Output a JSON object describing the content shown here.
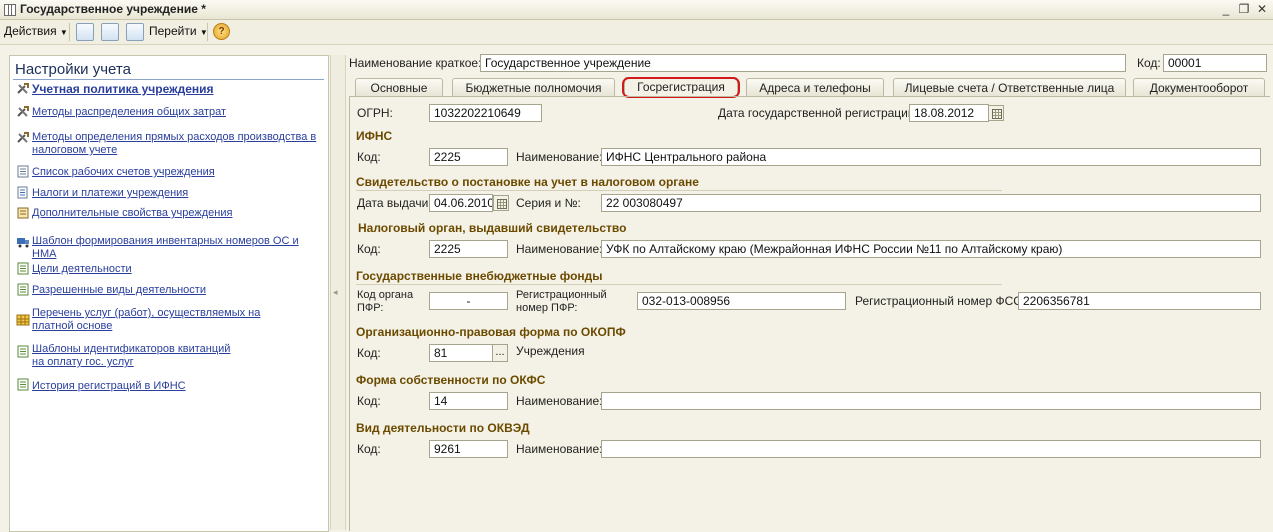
{
  "window": {
    "title": "Государственное учреждение *",
    "minimize": "_",
    "restore": "❐",
    "close": "✕"
  },
  "toolbar": {
    "actions_label": "Действия",
    "goto_label": "Перейти",
    "help_label": "?"
  },
  "left_panel": {
    "heading": "Настройки учета",
    "items": [
      {
        "label": "Учетная политика учреждения",
        "icon": "tools-icon"
      },
      {
        "label": "Методы распределения общих затрат",
        "icon": "tools-icon"
      },
      {
        "label": "Методы определения прямых расходов производства в налоговом учете",
        "icon": "tools-icon"
      },
      {
        "label": "Список рабочих счетов учреждения",
        "icon": "list-icon"
      },
      {
        "label": "Налоги и платежи учреждения",
        "icon": "document-icon"
      },
      {
        "label": "Дополнительные свойства учреждения",
        "icon": "properties-icon"
      },
      {
        "label": "Шаблон формирования инвентарных номеров ОС и НМА",
        "icon": "truck-icon"
      },
      {
        "label": "Цели деятельности",
        "icon": "list-icon"
      },
      {
        "label": "Разрешенные виды деятельности",
        "icon": "list-icon"
      },
      {
        "label": "Перечень услуг (работ), осуществляемых на платной основе",
        "icon": "table-icon"
      },
      {
        "label": "Шаблоны идентификаторов квитанций на оплату гос. услуг",
        "icon": "list-icon"
      },
      {
        "label": "История регистраций в ИФНС",
        "icon": "list-icon"
      }
    ]
  },
  "header": {
    "short_name_label": "Наименование краткое:",
    "short_name_value": "Государственное учреждение",
    "code_label": "Код:",
    "code_value": "00001"
  },
  "tabs": [
    {
      "label": "Основные"
    },
    {
      "label": "Бюджетные полномочия"
    },
    {
      "label": "Госрегистрация"
    },
    {
      "label": "Адреса и телефоны"
    },
    {
      "label": "Лицевые счета / Ответственные лица"
    },
    {
      "label": "Документооборот"
    }
  ],
  "form": {
    "ogrn_label": "ОГРН:",
    "ogrn_value": "1032202210649",
    "reg_date_label": "Дата государственной регистрации:",
    "reg_date_value": "18.08.2012",
    "ifns": {
      "title": "ИФНС",
      "code_label": "Код:",
      "code_value": "2225",
      "name_label": "Наименование:",
      "name_value": "ИФНС Центрального района"
    },
    "certificate": {
      "title": "Свидетельство о постановке на учет в налоговом органе",
      "issue_date_label": "Дата выдачи:",
      "issue_date_value": "04.06.2010",
      "series_label": "Серия и №:",
      "series_value": "22 003080497"
    },
    "tax_authority": {
      "title": "Налоговый орган, выдавший свидетельство",
      "code_label": "Код:",
      "code_value": "2225",
      "name_label": "Наименование:",
      "name_value": "УФК по Алтайскому краю (Межрайонная ИФНС России №11 по Алтайскому краю)"
    },
    "funds": {
      "title": "Государственные внебюджетные фонды",
      "pfr_code_label": "Код органа ПФР:",
      "pfr_code_value": "-",
      "pfr_reg_label": "Регистрационный номер ПФР:",
      "pfr_reg_value": "032-013-008956",
      "fss_reg_label": "Регистрационный номер ФСС:",
      "fss_reg_value": "2206356781"
    },
    "okopf": {
      "title": "Организационно-правовая форма по ОКОПФ",
      "code_label": "Код:",
      "code_value": "81",
      "picker_label": "...",
      "name_value": "Учреждения"
    },
    "okfs": {
      "title": "Форма собственности по ОКФС",
      "code_label": "Код:",
      "code_value": "14",
      "name_label": "Наименование:",
      "name_value": ""
    },
    "okved": {
      "title": "Вид деятельности по ОКВЭД",
      "code_label": "Код:",
      "code_value": "9261",
      "name_label": "Наименование:",
      "name_value": ""
    }
  },
  "colors": {
    "section_title": "#6b4a00",
    "link": "#2a3f9c",
    "tab_highlight": "#d21a1a",
    "background": "#f4f2e6"
  }
}
